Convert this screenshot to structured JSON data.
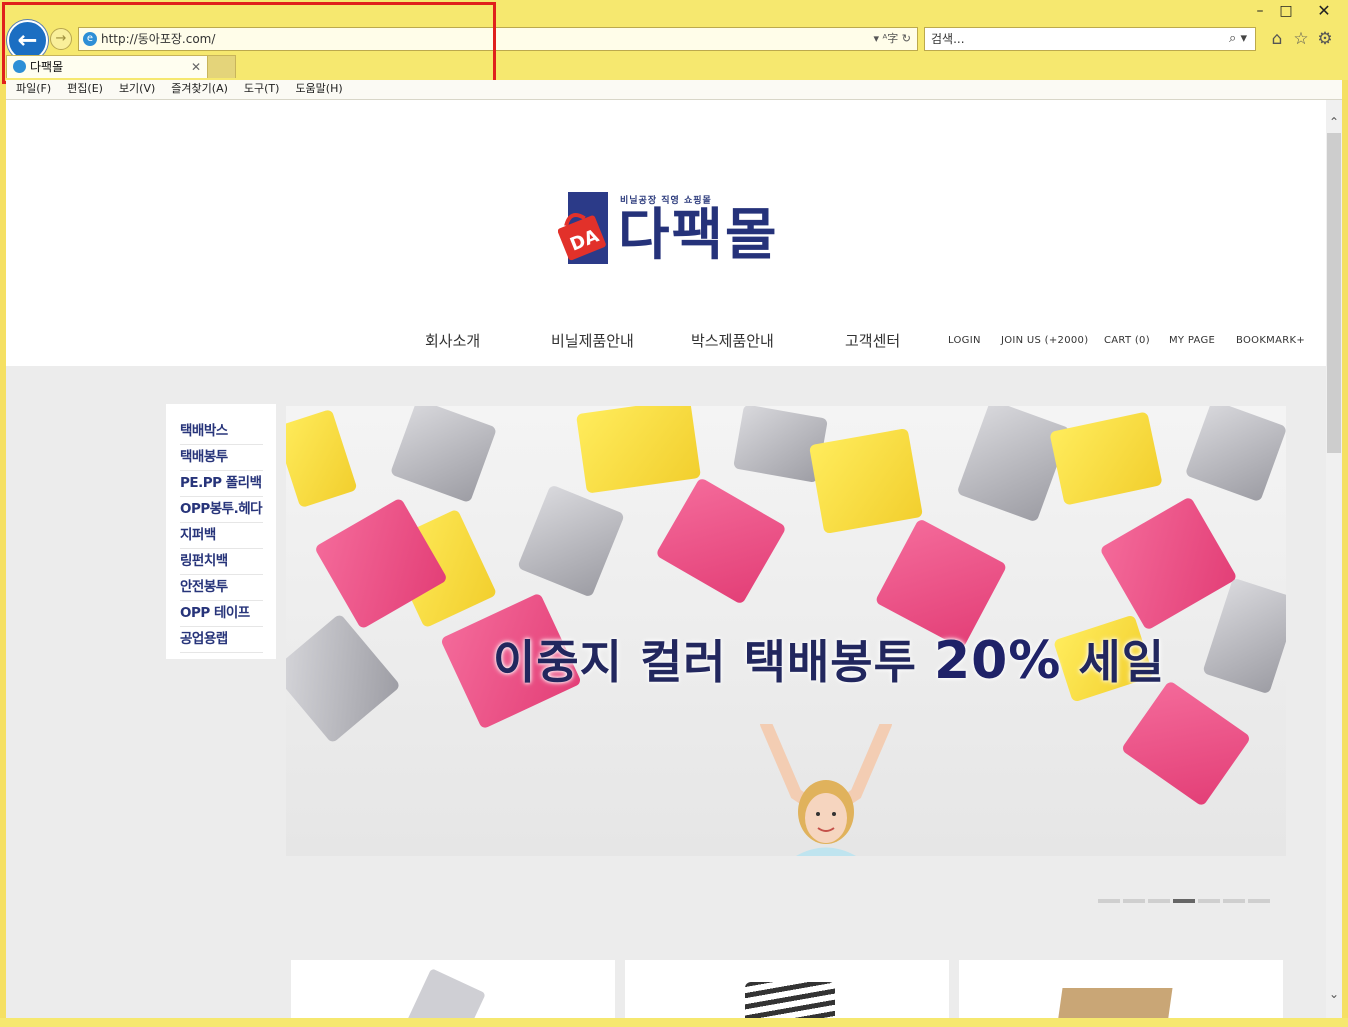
{
  "browser": {
    "address": "http://동아포장.com/",
    "search_placeholder": "검색...",
    "tab_title": "다팩몰",
    "menu": [
      "파일(F)",
      "편집(E)",
      "보기(V)",
      "즐겨찾기(A)",
      "도구(T)",
      "도움말(H)"
    ]
  },
  "site": {
    "logo_tagline": "비닐공장 직영 쇼핑몰",
    "logo_name": "다팩몰",
    "logo_mark": "DA",
    "gnb": [
      "회사소개",
      "비닐제품안내",
      "박스제품안내",
      "고객센터"
    ],
    "util": [
      "LOGIN",
      "JOIN US (+2000)",
      "CART (0)",
      "MY PAGE",
      "BOOKMARK+"
    ],
    "categories": [
      "택배박스",
      "택배봉투",
      "PE.PP 폴리백",
      "OPP봉투.헤다",
      "지퍼백",
      "링펀치백",
      "안전봉투",
      "OPP 테이프",
      "공업용랩"
    ],
    "banner": {
      "slogan_part1": "이중지 컬러 택배봉투",
      "slogan_pct": "20%",
      "slogan_part2": "세일"
    },
    "slider": {
      "count": 7,
      "active_index": 3
    }
  },
  "colors": {
    "brand_navy": "#25327a",
    "brand_red": "#e2312a",
    "chrome_yellow": "#f6e86f"
  }
}
